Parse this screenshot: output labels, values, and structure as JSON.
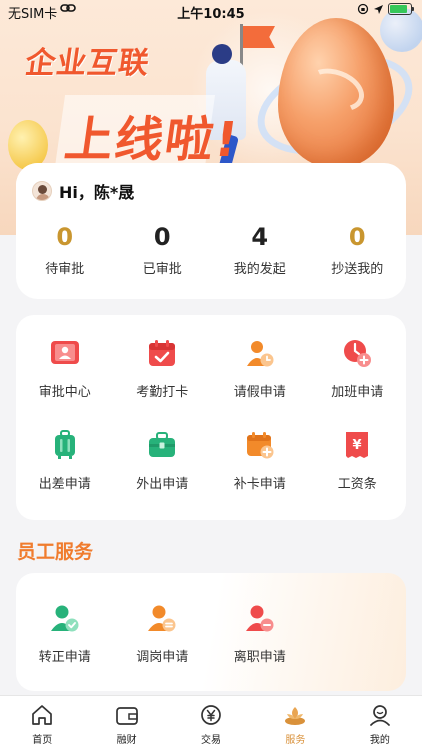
{
  "status_bar": {
    "carrier": "无SIM卡",
    "time": "上午10:45"
  },
  "banner": {
    "title_line1": "企业互联",
    "title_line2": "上线啦!"
  },
  "greeting": {
    "text": "Hi，陈*晟"
  },
  "stats": [
    {
      "value": "0",
      "label": "待审批",
      "color": "#c9962f"
    },
    {
      "value": "0",
      "label": "已审批",
      "color": "#222222"
    },
    {
      "value": "4",
      "label": "我的发起",
      "color": "#222222"
    },
    {
      "value": "0",
      "label": "抄送我的",
      "color": "#c9962f"
    }
  ],
  "apps": [
    {
      "label": "审批中心",
      "icon": "approval-center-icon"
    },
    {
      "label": "考勤打卡",
      "icon": "attendance-calendar-icon"
    },
    {
      "label": "请假申请",
      "icon": "leave-request-icon"
    },
    {
      "label": "加班申请",
      "icon": "overtime-clock-icon"
    },
    {
      "label": "出差申请",
      "icon": "luggage-icon"
    },
    {
      "label": "外出申请",
      "icon": "briefcase-icon"
    },
    {
      "label": "补卡申请",
      "icon": "calendar-add-icon"
    },
    {
      "label": "工资条",
      "icon": "payslip-yen-icon"
    }
  ],
  "section": {
    "title": "员工服务"
  },
  "services": [
    {
      "label": "转正申请",
      "icon": "user-check-icon"
    },
    {
      "label": "调岗申请",
      "icon": "user-transfer-icon"
    },
    {
      "label": "离职申请",
      "icon": "user-remove-icon"
    }
  ],
  "tabs": [
    {
      "label": "首页",
      "icon": "home-icon"
    },
    {
      "label": "融财",
      "icon": "wallet-icon"
    },
    {
      "label": "交易",
      "icon": "yen-exchange-icon"
    },
    {
      "label": "服务",
      "icon": "service-lotus-icon",
      "active": true
    },
    {
      "label": "我的",
      "icon": "profile-icon"
    }
  ],
  "colors": {
    "accent_orange": "#f07c2e",
    "stat_gold": "#c9962f",
    "icon_red": "#ef4b4b",
    "icon_green": "#27b27a",
    "icon_orange": "#f28a2a",
    "tab_active": "#d9913a"
  }
}
